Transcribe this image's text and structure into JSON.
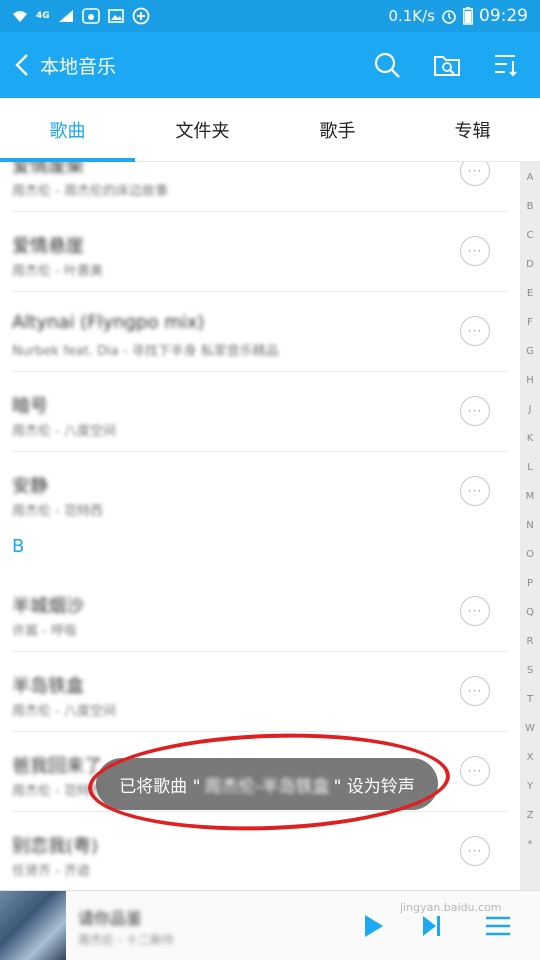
{
  "status_bar": {
    "network": "4G",
    "speed": "0.1K/s",
    "time": "09:29"
  },
  "header": {
    "title": "本地音乐",
    "accent_color": "#1ca8f2",
    "icons": [
      "back-icon",
      "search-icon",
      "folder-search-icon",
      "sort-icon"
    ]
  },
  "tabs": [
    {
      "label": "歌曲",
      "active": true
    },
    {
      "label": "文件夹",
      "active": false
    },
    {
      "label": "歌手",
      "active": false
    },
    {
      "label": "专辑",
      "active": false
    }
  ],
  "songs": [
    {
      "title": "爱情废柴",
      "subtitle": "周杰伦 - 周杰伦的床边故事"
    },
    {
      "title": "爱情悬崖",
      "subtitle": "周杰伦 - 叶惠美"
    },
    {
      "title": "Altynai (Flyngpo mix)",
      "subtitle": "Nurbek feat. Dia - 寻找下半身 私家音乐精品"
    },
    {
      "title": "暗号",
      "subtitle": "周杰伦 - 八度空间"
    },
    {
      "title": "安静",
      "subtitle": "周杰伦 - 范特西"
    },
    {
      "title": "半城烟沙",
      "subtitle": "许嵩 - 呼吸"
    },
    {
      "title": "半岛铁盒",
      "subtitle": "周杰伦 - 八度空间"
    },
    {
      "title": "爸我回来了",
      "subtitle": "周杰伦 - 范特西"
    },
    {
      "title": "别恋我(粤)",
      "subtitle": "任贤齐 - 齐迹"
    }
  ],
  "section_b": "B",
  "index_letters": [
    "A",
    "B",
    "C",
    "D",
    "E",
    "F",
    "G",
    "H",
    "J",
    "K",
    "L",
    "M",
    "N",
    "O",
    "P",
    "Q",
    "R",
    "S",
    "T",
    "W",
    "X",
    "Y",
    "Z",
    "*"
  ],
  "toast": {
    "prefix": "已将歌曲 \"",
    "song": "周杰伦-半岛铁盒",
    "suffix": "\" 设为铃声"
  },
  "player": {
    "title": "请你品鉴",
    "subtitle": "周杰伦 - 十二新作"
  },
  "watermark": "jingyan.baidu.com"
}
